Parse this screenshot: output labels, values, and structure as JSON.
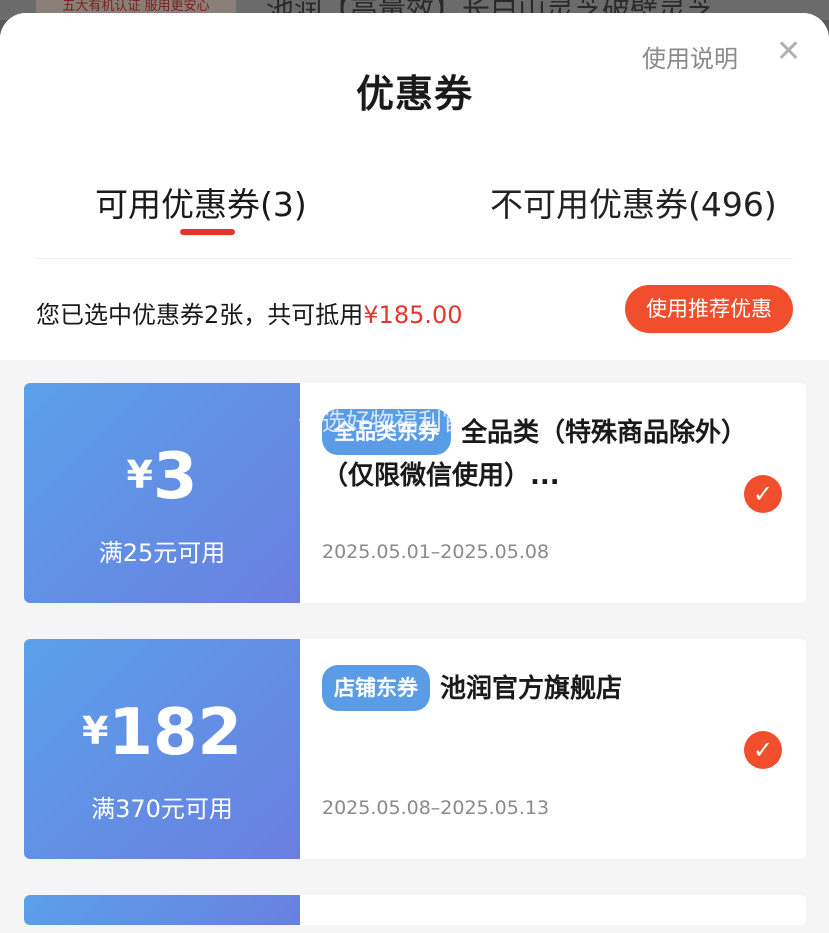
{
  "background": {
    "thumb_text": "五大有机认证 服用更安心",
    "title": "池润【高量效】长白山灵芝破壁灵芝..."
  },
  "sheet": {
    "title": "优惠券",
    "help_link": "使用说明",
    "close_glyph": "✕"
  },
  "tabs": [
    {
      "label": "可用优惠券(3)"
    },
    {
      "label": "不可用优惠券(496)"
    }
  ],
  "summary": {
    "prefix": "您已选中优惠券2张，共可抵用",
    "amount": "¥185.00",
    "recommend_button": "使用推荐优惠"
  },
  "watermark": "优选好物福利官",
  "coupons": [
    {
      "currency": "¥",
      "value": "3",
      "condition": "满25元可用",
      "tag": "全品类东券",
      "name": "全品类（特殊商品除外）（仅限微信使用）...",
      "date": "2025.05.01–2025.05.08",
      "selected_glyph": "✓"
    },
    {
      "currency": "¥",
      "value": "182",
      "condition": "满370元可用",
      "tag": "店铺东券",
      "name": "池润官方旗舰店",
      "date": "2025.05.08–2025.05.13",
      "selected_glyph": "✓"
    }
  ],
  "colors": {
    "accent": "#e8352a",
    "button": "#f04e2c",
    "coupon_blue": "#5ba0ea"
  }
}
